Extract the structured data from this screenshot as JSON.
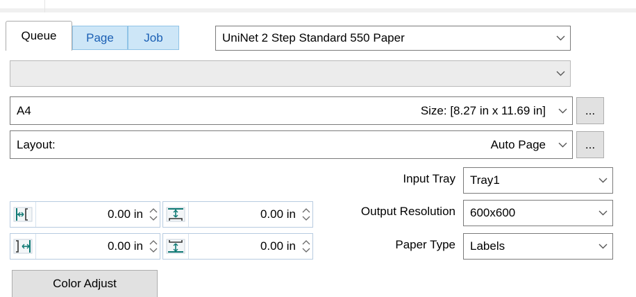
{
  "tabs": [
    {
      "label": "Queue",
      "active": true
    },
    {
      "label": "Page",
      "active": false
    },
    {
      "label": "Job",
      "active": false
    }
  ],
  "driver_select": {
    "value": "UniNet 2 Step Standard 550 Paper"
  },
  "profile_select": {
    "value": ""
  },
  "paper_size": {
    "value": "A4",
    "size_text": "Size: [8.27 in x 11.69 in]",
    "more_label": "..."
  },
  "layout": {
    "label": "Layout:",
    "value": "Auto Page",
    "more_label": "..."
  },
  "input_tray": {
    "label": "Input Tray",
    "value": "Tray1"
  },
  "output_resolution": {
    "label": "Output Resolution",
    "value": "600x600"
  },
  "paper_type": {
    "label": "Paper Type",
    "value": "Labels"
  },
  "margins": {
    "left": "0.00 in",
    "top": "0.00 in",
    "right": "0.00 in",
    "bottom": "0.00 in"
  },
  "color_adjust_label": "Color Adjust",
  "colors": {
    "accent_tab": "#cde6f7",
    "tab_text": "#1a5fb4",
    "icon_teal": "#0f7a74"
  }
}
